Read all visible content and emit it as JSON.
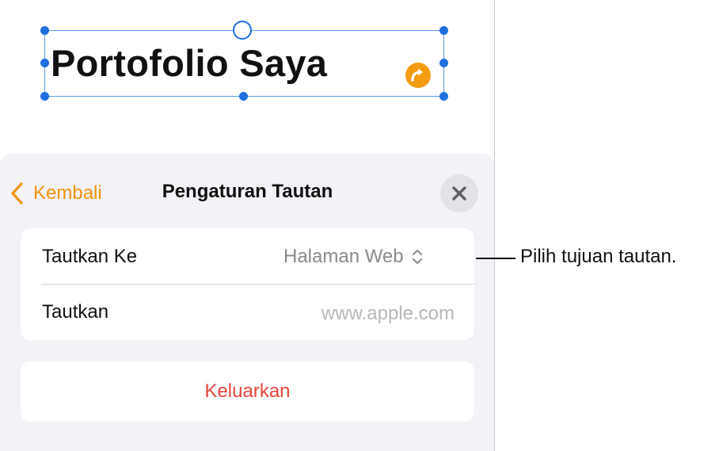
{
  "canvas": {
    "textbox_title": "Portofolio Saya"
  },
  "sheet": {
    "back_label": "Kembali",
    "title": "Pengaturan Tautan",
    "rows": {
      "link_to_label": "Tautkan Ke",
      "link_to_value": "Halaman Web",
      "link_label": "Tautkan",
      "link_placeholder": "www.apple.com"
    },
    "remove_label": "Keluarkan"
  },
  "callout": {
    "text": "Pilih tujuan tautan."
  },
  "colors": {
    "accent": "#f0940f",
    "selection": "#1f6fe0",
    "destructive": "#e8453c",
    "sheet_background": "#f2f2f7"
  },
  "icons": [
    "chevron-left-icon",
    "close-icon",
    "chevron-up-down-icon",
    "link-arrow-icon"
  ]
}
